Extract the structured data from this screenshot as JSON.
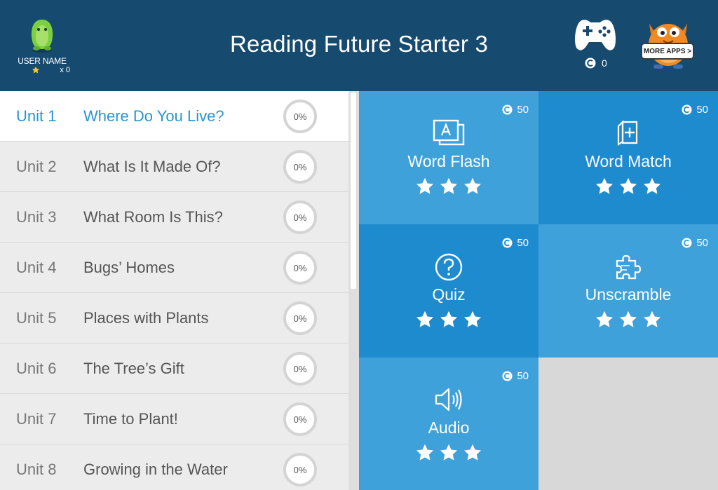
{
  "header": {
    "title": "Reading Future Starter 3",
    "user_name": "USER NAME",
    "star_count": "x 0",
    "coin_count": "0",
    "more_apps_label": "MORE APPS >"
  },
  "units": [
    {
      "num": "Unit 1",
      "title": "Where Do You Live?",
      "progress": "0%",
      "active": true
    },
    {
      "num": "Unit 2",
      "title": "What Is It Made Of?",
      "progress": "0%"
    },
    {
      "num": "Unit 3",
      "title": "What Room Is This?",
      "progress": "0%"
    },
    {
      "num": "Unit 4",
      "title": "Bugs’ Homes",
      "progress": "0%"
    },
    {
      "num": "Unit 5",
      "title": "Places with Plants",
      "progress": "0%"
    },
    {
      "num": "Unit 6",
      "title": "The Tree’s Gift",
      "progress": "0%"
    },
    {
      "num": "Unit 7",
      "title": "Time to Plant!",
      "progress": "0%"
    },
    {
      "num": "Unit 8",
      "title": "Growing in the Water",
      "progress": "0%"
    }
  ],
  "activities": [
    {
      "label": "Word Flash",
      "cost": "50",
      "icon": "flashcard-icon",
      "stars": 3
    },
    {
      "label": "Word Match",
      "cost": "50",
      "icon": "card-add-icon",
      "stars": 3
    },
    {
      "label": "Quiz",
      "cost": "50",
      "icon": "question-icon",
      "stars": 3
    },
    {
      "label": "Unscramble",
      "cost": "50",
      "icon": "puzzle-icon",
      "stars": 3
    },
    {
      "label": "Audio",
      "cost": "50",
      "icon": "speaker-icon",
      "stars": 3
    }
  ],
  "colors": {
    "header_bg": "#174a6f",
    "accent": "#2996d1",
    "tile_light": "#3fa1d9",
    "tile_dark": "#1e8bcf"
  }
}
